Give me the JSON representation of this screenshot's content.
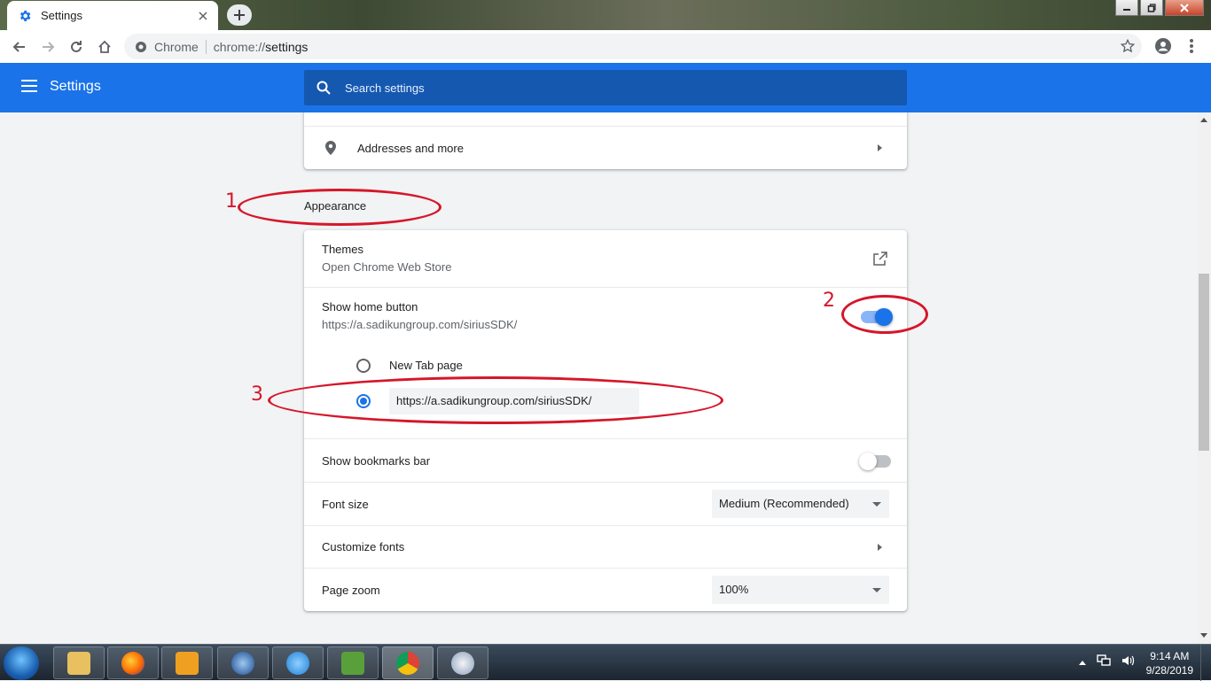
{
  "browser": {
    "tab_title": "Settings",
    "site_chip": "Chrome",
    "url_scheme": "chrome://",
    "url_rest": "settings"
  },
  "header": {
    "title": "Settings",
    "search_placeholder": "Search settings"
  },
  "autofill": {
    "addresses_label": "Addresses and more"
  },
  "appearance": {
    "section_title": "Appearance",
    "themes": {
      "label": "Themes",
      "sublabel": "Open Chrome Web Store"
    },
    "home_button": {
      "label": "Show home button",
      "sublabel": "https://a.sadikungroup.com/siriusSDK/",
      "enabled": true,
      "option_new_tab": "New Tab page",
      "custom_url": "https://a.sadikungroup.com/siriusSDK/",
      "selected": "custom"
    },
    "bookmarks_bar": {
      "label": "Show bookmarks bar",
      "enabled": false
    },
    "font_size": {
      "label": "Font size",
      "value": "Medium (Recommended)"
    },
    "customize_fonts": {
      "label": "Customize fonts"
    },
    "page_zoom": {
      "label": "Page zoom",
      "value": "100%"
    }
  },
  "annotations": [
    "1",
    "2",
    "3"
  ],
  "taskbar": {
    "time": "9:14 AM",
    "date": "9/28/2019"
  },
  "colors": {
    "header_blue": "#1a73e8",
    "search_blue": "#1558b0",
    "annotation_red": "#d6162a"
  }
}
